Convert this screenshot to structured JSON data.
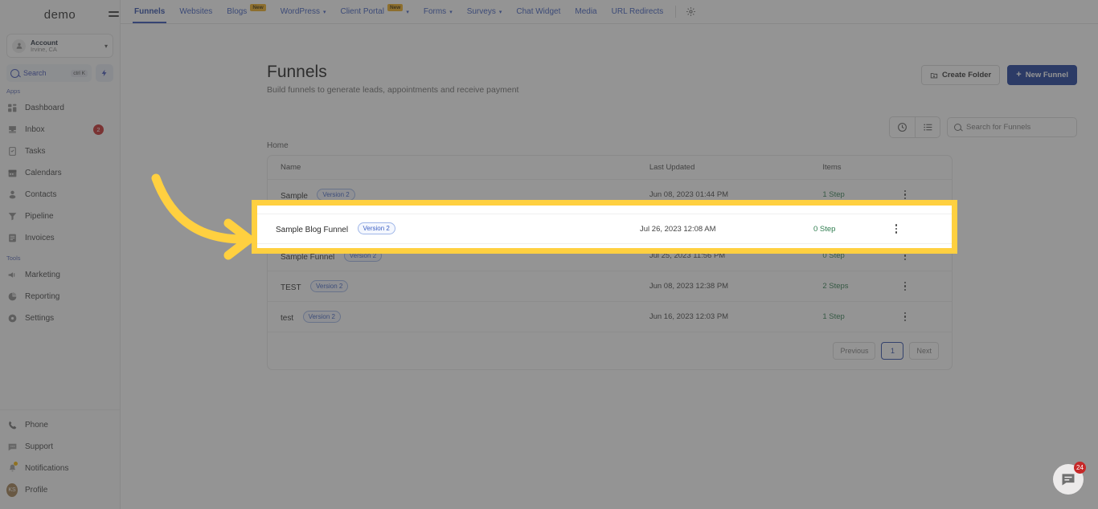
{
  "sidebar": {
    "logo": "demo",
    "collapse_icon": "collapse-menu-icon",
    "account": {
      "name": "Account",
      "location": "Irvine, CA"
    },
    "search": {
      "label": "Search",
      "shortcut": "ctrl K"
    },
    "groups": [
      {
        "label": "Apps",
        "items": [
          {
            "label": "Dashboard",
            "icon": "dashboard-icon",
            "badge": ""
          },
          {
            "label": "Inbox",
            "icon": "inbox-icon",
            "badge": "2"
          },
          {
            "label": "Tasks",
            "icon": "tasks-icon",
            "badge": ""
          },
          {
            "label": "Calendars",
            "icon": "calendar-icon",
            "badge": ""
          },
          {
            "label": "Contacts",
            "icon": "contacts-icon",
            "badge": ""
          },
          {
            "label": "Pipeline",
            "icon": "pipeline-icon",
            "badge": ""
          },
          {
            "label": "Invoices",
            "icon": "invoices-icon",
            "badge": ""
          }
        ]
      },
      {
        "label": "Tools",
        "items": [
          {
            "label": "Marketing",
            "icon": "marketing-icon",
            "badge": ""
          },
          {
            "label": "Reporting",
            "icon": "reporting-icon",
            "badge": ""
          },
          {
            "label": "Settings",
            "icon": "settings-icon",
            "badge": ""
          }
        ]
      }
    ],
    "bottom": [
      {
        "label": "Phone",
        "icon": "phone-icon"
      },
      {
        "label": "Support",
        "icon": "support-chat-icon"
      },
      {
        "label": "Notifications",
        "icon": "bell-icon"
      },
      {
        "label": "Profile",
        "icon": "avatar-icon",
        "initials": "KS"
      }
    ]
  },
  "topbar": {
    "tabs": [
      {
        "label": "Funnels",
        "active": true,
        "badge": "",
        "caret": false
      },
      {
        "label": "Websites",
        "active": false,
        "badge": "",
        "caret": false
      },
      {
        "label": "Blogs",
        "active": false,
        "badge": "New",
        "caret": false
      },
      {
        "label": "WordPress",
        "active": false,
        "badge": "",
        "caret": true
      },
      {
        "label": "Client Portal",
        "active": false,
        "badge": "New",
        "caret": true
      },
      {
        "label": "Forms",
        "active": false,
        "badge": "",
        "caret": true
      },
      {
        "label": "Surveys",
        "active": false,
        "badge": "",
        "caret": true
      },
      {
        "label": "Chat Widget",
        "active": false,
        "badge": "",
        "caret": false
      },
      {
        "label": "Media",
        "active": false,
        "badge": "",
        "caret": false
      },
      {
        "label": "URL Redirects",
        "active": false,
        "badge": "",
        "caret": false
      }
    ],
    "settings_icon": "gear-icon"
  },
  "page": {
    "title": "Funnels",
    "subtitle": "Build funnels to generate leads, appointments and receive payment",
    "create_folder_label": "Create Folder",
    "new_funnel_label": "New Funnel",
    "new_funnel_plus": "+",
    "breadcrumb": "Home"
  },
  "toolbar": {
    "recent_icon": "clock-icon",
    "list_icon": "list-view-icon",
    "search_placeholder": "Search for Funnels",
    "search_value": ""
  },
  "table": {
    "columns": [
      "Name",
      "Last Updated",
      "Items"
    ],
    "rows": [
      {
        "name": "Sample",
        "version": "Version 2",
        "updated": "Jun 08, 2023 01:44 PM",
        "items": "1 Step"
      },
      {
        "name": "Sample Blog Funnel",
        "version": "Version 2",
        "updated": "Jul 26, 2023 12:08 AM",
        "items": "0 Step"
      },
      {
        "name": "Sample Funnel",
        "version": "Version 2",
        "updated": "Jul 25, 2023 11:56 PM",
        "items": "0 Step"
      },
      {
        "name": "TEST",
        "version": "Version 2",
        "updated": "Jun 08, 2023 12:38 PM",
        "items": "2 Steps"
      },
      {
        "name": "test",
        "version": "Version 2",
        "updated": "Jun 16, 2023 12:03 PM",
        "items": "1 Step"
      }
    ]
  },
  "pagination": {
    "previous": "Previous",
    "current": "1",
    "next": "Next"
  },
  "chat": {
    "icon": "chat-bubble-icon",
    "badge": "24"
  },
  "annotation": {
    "highlight_color": "#ffd040",
    "arrow_icon": "curved-arrow-right-icon",
    "highlighted_row_index": 1
  },
  "colors": {
    "accent_blue": "#1a3a99",
    "tab_blue": "#3b5bbf",
    "highlight_yellow": "#ffd040",
    "badge_red": "#c62828",
    "steps_green": "#2f7d4f"
  }
}
